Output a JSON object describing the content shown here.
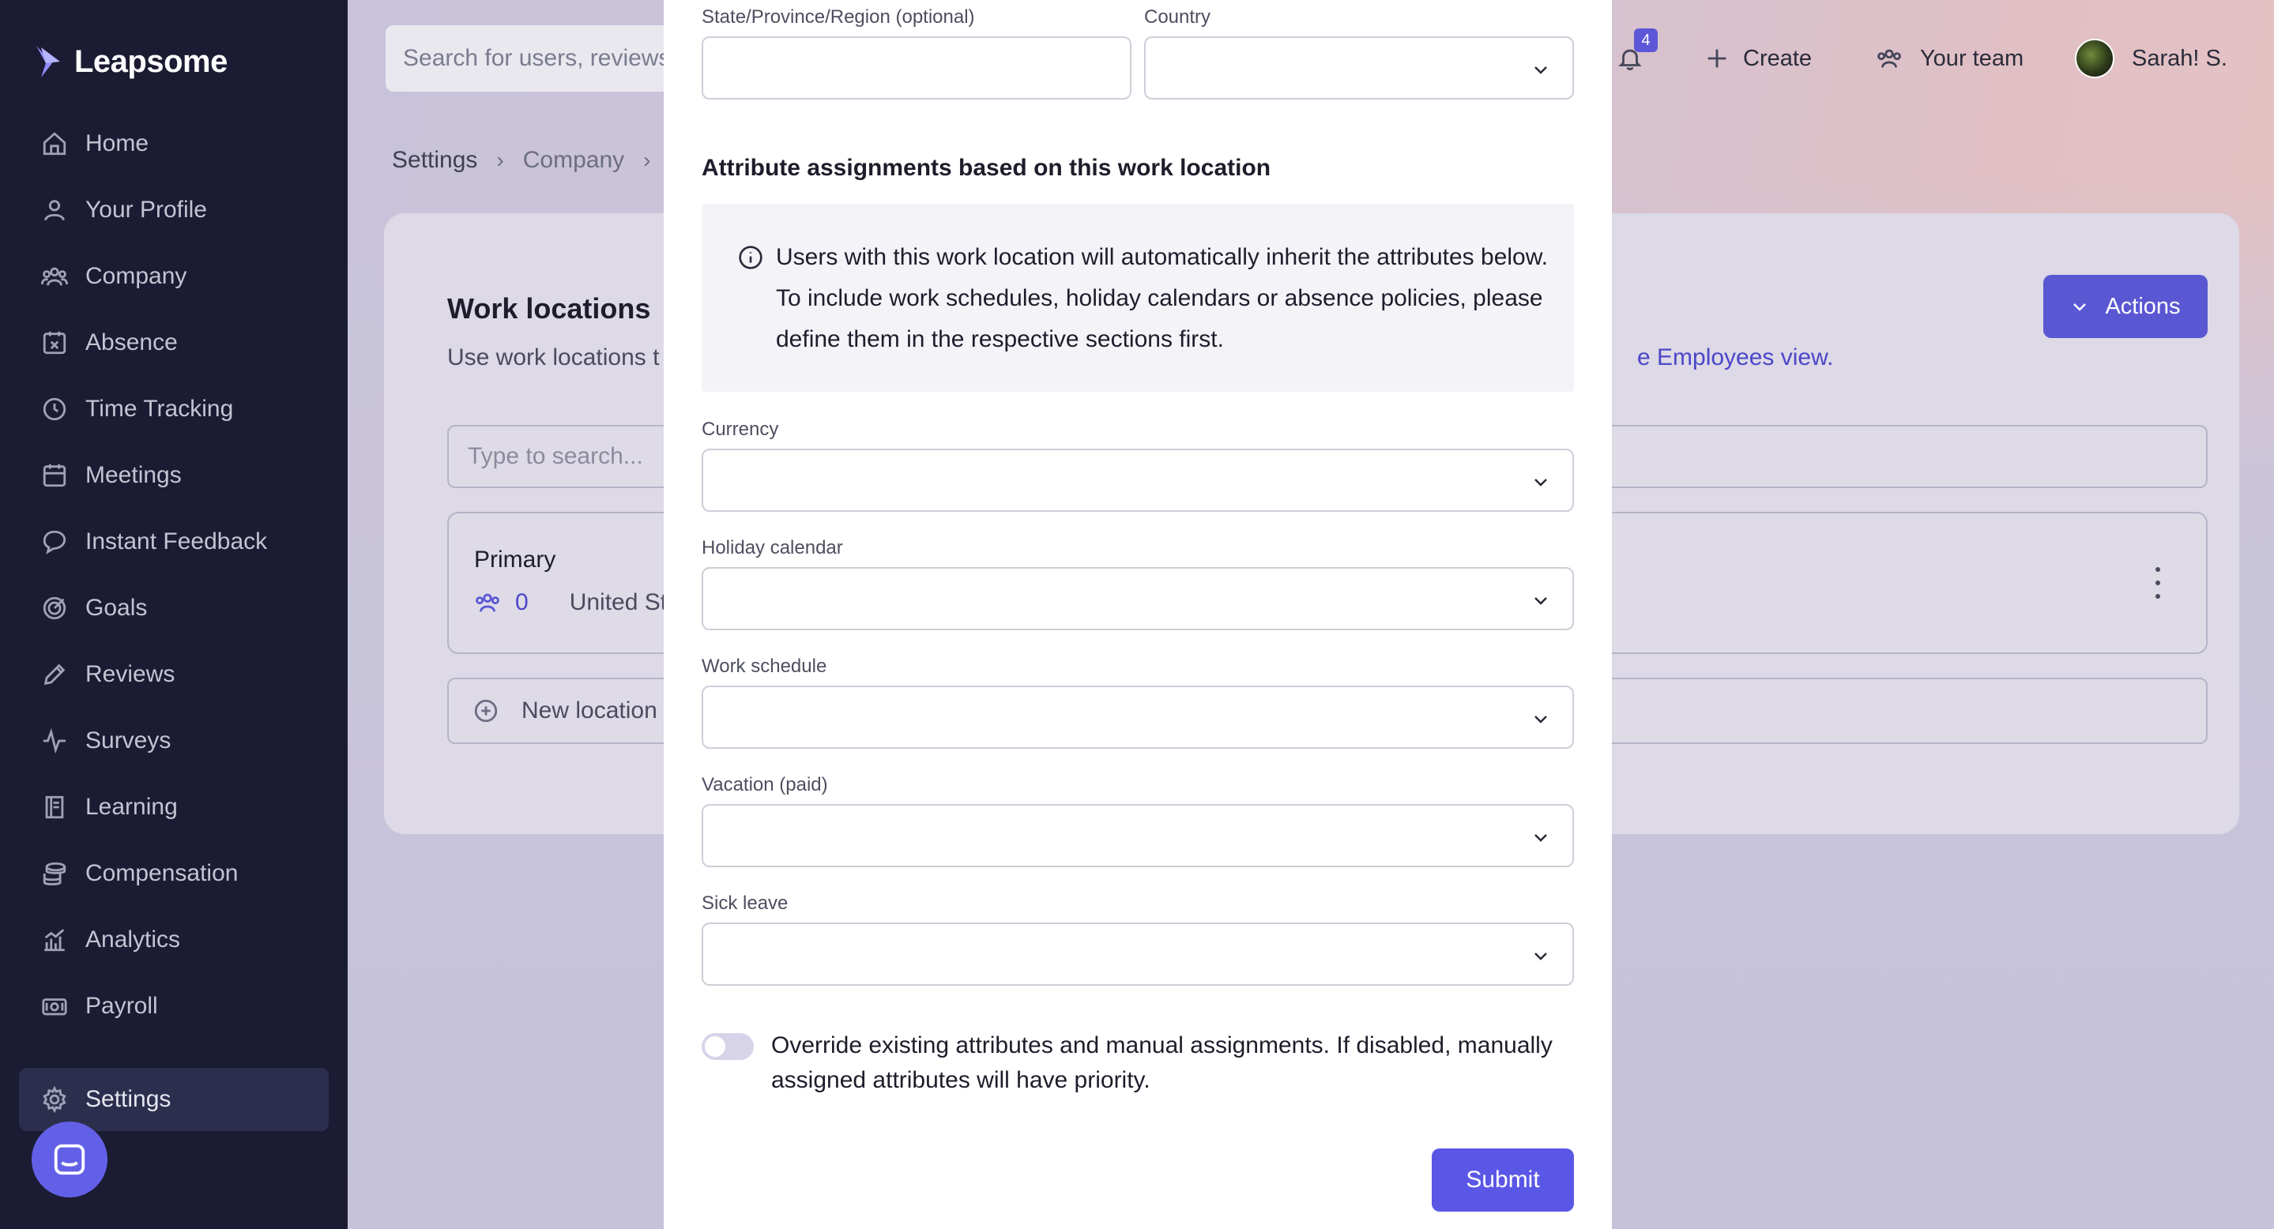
{
  "sidebar": {
    "logo": "Leapsome",
    "items": [
      {
        "label": "Home",
        "icon": "home-icon"
      },
      {
        "label": "Your Profile",
        "icon": "user-icon"
      },
      {
        "label": "Company",
        "icon": "users-icon"
      },
      {
        "label": "Absence",
        "icon": "calendar-x-icon"
      },
      {
        "label": "Time Tracking",
        "icon": "clock-icon"
      },
      {
        "label": "Meetings",
        "icon": "calendar-icon"
      },
      {
        "label": "Instant Feedback",
        "icon": "chat-icon"
      },
      {
        "label": "Goals",
        "icon": "target-icon"
      },
      {
        "label": "Reviews",
        "icon": "pencil-icon"
      },
      {
        "label": "Surveys",
        "icon": "pulse-icon"
      },
      {
        "label": "Learning",
        "icon": "book-icon"
      },
      {
        "label": "Compensation",
        "icon": "coins-icon"
      },
      {
        "label": "Analytics",
        "icon": "chart-icon"
      },
      {
        "label": "Payroll",
        "icon": "cash-icon"
      }
    ],
    "active_item": {
      "label": "Settings",
      "icon": "gear-icon"
    }
  },
  "header": {
    "search_placeholder": "Search for users, reviews",
    "notification_count": "4",
    "create_label": "Create",
    "team_label": "Your team",
    "user_name": "Sarah! S."
  },
  "breadcrumb": {
    "items": [
      "Settings",
      "Company"
    ]
  },
  "work_locations": {
    "title": "Work locations",
    "subtitle": "Use work locations t",
    "link_text": "e Employees view.",
    "actions_label": "Actions",
    "search_placeholder": "Type to search...",
    "locations": [
      {
        "name": "Primary",
        "count": "0",
        "country": "United Sta"
      }
    ],
    "new_location_label": "New location"
  },
  "modal": {
    "state_label": "State/Province/Region (optional)",
    "state_value": "",
    "country_label": "Country",
    "country_value": "",
    "section_title": "Attribute assignments based on this work location",
    "info_text": "Users with this work location will automatically inherit the attributes below. To include work schedules, holiday calendars or absence policies, please define them in the respective sections first.",
    "fields": [
      {
        "label": "Currency",
        "value": ""
      },
      {
        "label": "Holiday calendar",
        "value": ""
      },
      {
        "label": "Work schedule",
        "value": ""
      },
      {
        "label": "Vacation (paid)",
        "value": ""
      },
      {
        "label": "Sick leave",
        "value": ""
      }
    ],
    "override_text": "Override existing attributes and manual assignments. If disabled, manually assigned attributes will have priority.",
    "override_enabled": false,
    "submit_label": "Submit"
  },
  "colors": {
    "sidebar_bg": "#1b1c33",
    "accent": "#5b57e6",
    "link": "#4b47c9"
  }
}
